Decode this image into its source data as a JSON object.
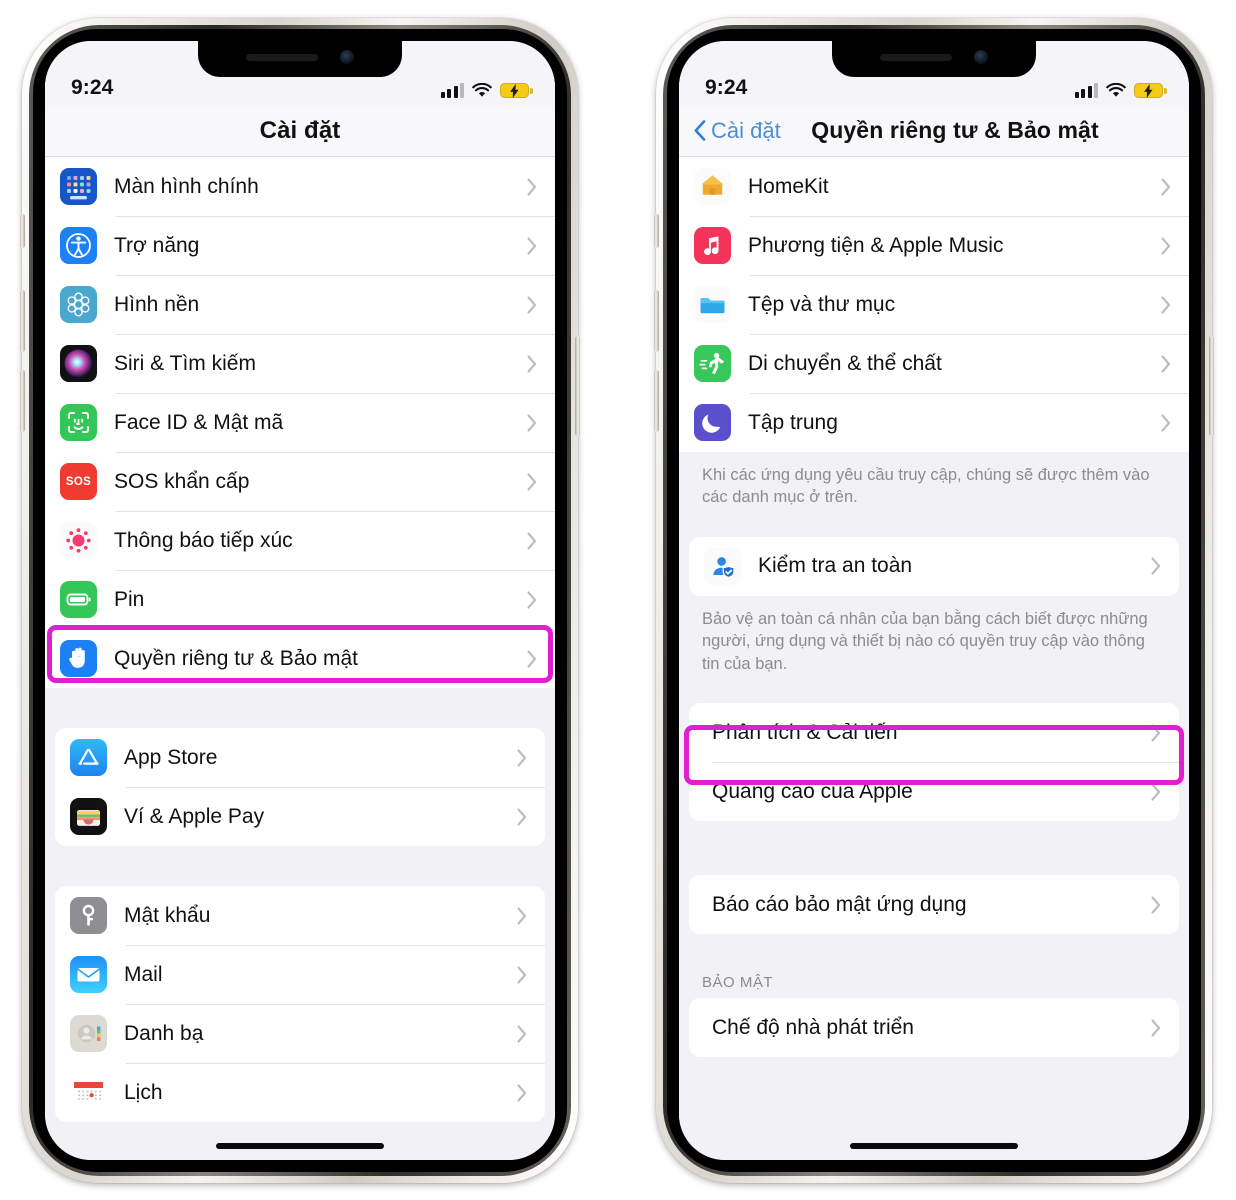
{
  "phones": [
    {
      "id": "settings-list",
      "status": {
        "time": "9:24",
        "signal_icon": "cellular-bars-icon",
        "wifi_icon": "wifi-icon",
        "battery_icon": "battery-charging-low-power-icon"
      },
      "nav": {
        "title": "Cài đặt",
        "back_label": null
      },
      "groups": [
        {
          "flush": true,
          "rows": [
            {
              "icon": "home-screen-icon",
              "label": "Màn hình chính"
            },
            {
              "icon": "accessibility-icon",
              "label": "Trợ năng"
            },
            {
              "icon": "wallpaper-icon",
              "label": "Hình nền"
            },
            {
              "icon": "siri-search-icon",
              "label": "Siri & Tìm kiếm"
            },
            {
              "icon": "face-id-icon",
              "label": "Face ID & Mật mã"
            },
            {
              "icon": "sos-icon",
              "label": "SOS khẩn cấp"
            },
            {
              "icon": "exposure-notification-icon",
              "label": "Thông báo tiếp xúc"
            },
            {
              "icon": "battery-icon",
              "label": "Pin"
            },
            {
              "icon": "privacy-hand-icon",
              "label": "Quyền riêng tư & Bảo mật",
              "highlighted": true
            }
          ]
        },
        {
          "rows": [
            {
              "icon": "app-store-icon",
              "label": "App Store"
            },
            {
              "icon": "wallet-icon",
              "label": "Ví & Apple Pay"
            }
          ]
        },
        {
          "rows": [
            {
              "icon": "passwords-key-icon",
              "label": "Mật khẩu"
            },
            {
              "icon": "mail-icon",
              "label": "Mail"
            },
            {
              "icon": "contacts-icon",
              "label": "Danh bạ"
            },
            {
              "icon": "calendar-icon",
              "label": "Lịch"
            }
          ]
        }
      ]
    },
    {
      "id": "privacy-security",
      "status": {
        "time": "9:24",
        "signal_icon": "cellular-bars-icon",
        "wifi_icon": "wifi-icon",
        "battery_icon": "battery-charging-low-power-icon"
      },
      "nav": {
        "title": "Quyền riêng tư & Bảo mật",
        "back_label": "Cài đặt"
      },
      "groups": [
        {
          "flush": true,
          "rows": [
            {
              "icon": "homekit-icon",
              "label": "HomeKit"
            },
            {
              "icon": "apple-music-icon",
              "label": "Phương tiện & Apple Music"
            },
            {
              "icon": "files-folder-icon",
              "label": "Tệp và thư mục"
            },
            {
              "icon": "fitness-motion-icon",
              "label": "Di chuyển & thể chất"
            },
            {
              "icon": "focus-moon-icon",
              "label": "Tập trung"
            }
          ]
        },
        {
          "footnote": "Khi các ứng dụng yêu cầu truy cập, chúng sẽ được thêm vào các danh mục ở trên."
        },
        {
          "rows": [
            {
              "icon": "safety-check-icon",
              "label": "Kiểm tra an toàn"
            }
          ]
        },
        {
          "footnote": "Bảo vệ an toàn cá nhân của bạn bằng cách biết được những người, ứng dụng và thiết bị nào có quyền truy cập vào thông tin của bạn."
        },
        {
          "rows": [
            {
              "label": "Phân tích & Cải tiến",
              "highlighted": true
            },
            {
              "label": "Quảng cáo của Apple"
            }
          ]
        },
        {
          "rows": [
            {
              "label": "Báo cáo bảo mật ứng dụng"
            }
          ]
        },
        {
          "header": "BẢO MẬT"
        },
        {
          "rows": [
            {
              "label": "Chế độ nhà phát triển"
            }
          ]
        }
      ]
    }
  ],
  "colors": {
    "highlight": "#e01fd0",
    "accent_blue": "#3f86d6",
    "screen_bg": "#f2f1f6",
    "row_bg": "#ffffff"
  }
}
